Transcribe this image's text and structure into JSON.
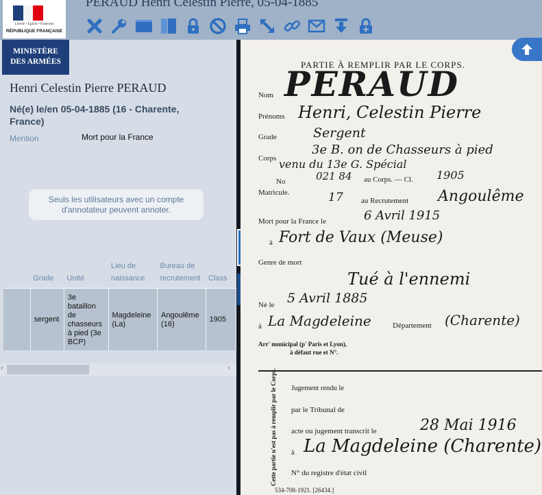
{
  "window_title": "PERAUD Henri Célestin Pierre, 05-04-1885",
  "logo": {
    "motto": "Liberté • Égalité • Fraternité",
    "republic": "RÉPUBLIQUE FRANÇAISE",
    "ministry_line1": "MINISTÈRE",
    "ministry_line2": "DES ARMÉES"
  },
  "toolbar": {
    "icons": [
      "close-icon",
      "wrench-icon",
      "single-view-icon",
      "split-view-icon",
      "lock-icon",
      "forbidden-icon",
      "print-icon",
      "fullscreen-icon",
      "link-icon",
      "mail-icon",
      "download-icon",
      "annotate-lock-icon"
    ]
  },
  "person": {
    "name": "Henri Celestin Pierre PERAUD",
    "birth": "Né(e) le/en 05-04-1885 (16 - Charente, France)",
    "mention_label": "Mention",
    "mention_value": "Mort pour la France"
  },
  "notice": "Seuls les utilisateurs avec un compte d'annotateur peuvent annoter.",
  "table": {
    "headers": [
      "",
      "Grade",
      "Unité",
      "Lieu de naissance",
      "Bureau de recrutement",
      "Class"
    ],
    "row": [
      "",
      "sergent",
      "3e bataillon de chasseurs à pied (3e BCP)",
      "Magdeleine (La)",
      "Angoulême (16)",
      "1905"
    ]
  },
  "scrollbar": {
    "left_arrow": "‹",
    "right_arrow": "›"
  },
  "annotations": {
    "count": "1"
  },
  "document": {
    "header": "PARTIE À REMPLIR PAR LE CORPS.",
    "lbl_nom": "Nom",
    "val_nom": "PERAUD",
    "lbl_prenoms": "Prénoms",
    "val_prenoms": "Henri, Celestin Pierre",
    "lbl_grade": "Grade",
    "val_grade": "Sergent",
    "lbl_corps": "Corps",
    "val_corps": "3e B. on de Chasseurs à pied",
    "val_corps2": "venu du 13e G. Spécial",
    "lbl_no": "No",
    "lbl_matricule": "Matricule.",
    "val_mat1": "021 84",
    "lbl_au_corps": "au Corps. — Cl.",
    "val_cl": "1905",
    "val_mat2": "17",
    "lbl_recrutement": "au Recrutement",
    "val_recrutement": "Angoulême",
    "lbl_mort": "Mort pour la France le",
    "val_mort_date": "6 Avril 1915",
    "lbl_a": "à",
    "val_lieu_mort": "Fort de Vaux (Meuse)",
    "lbl_genre": "Genre de mort",
    "val_genre": "Tué à l'ennemi",
    "lbl_ne": "Né le",
    "val_ne": "5 Avril 1885",
    "lbl_a2": "à",
    "val_ne_lieu": "La Magdeleine",
    "lbl_dept": "Département",
    "val_dept": "(Charente)",
    "lbl_arr": "Arr' municipal (p' Paris et Lyon),",
    "lbl_arr2": "à défaut rue et N°.",
    "side_note": "Cette partie n'est pas à remplir par le Corps.",
    "lbl_jugement": "Jugement rendu le",
    "lbl_tribunal": "par le Tribunal de",
    "lbl_acte": "acte ou jugement transcrit le",
    "val_acte": "28 Mai 1916",
    "lbl_a3": "à",
    "val_acte_lieu": "La Magdeleine (Charente)",
    "lbl_registre": "N° du registre d'état civil",
    "footer": "534-708-1921. [26434.]"
  },
  "colors": {
    "toolbar_bg": "#9fb2c8",
    "ministry_bg": "#1f3f7a",
    "accent": "#2a6cc0",
    "panel_bg": "#d6dde6"
  }
}
